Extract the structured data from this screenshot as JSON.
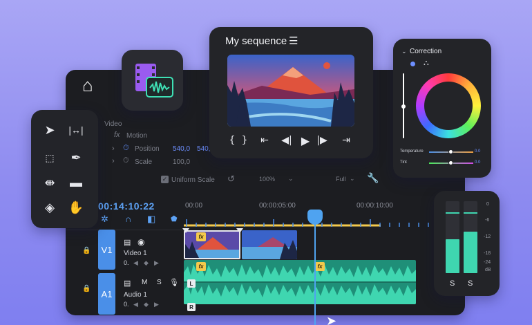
{
  "monitor": {
    "title": "My sequence",
    "menu_icon": "hamburger-icon",
    "transport": [
      "{",
      "}",
      "go-to-in",
      "step-back",
      "play",
      "step-forward",
      "go-to-out"
    ]
  },
  "correction": {
    "title": "Correction",
    "sliders": [
      {
        "label": "Temperature",
        "value": "0.0"
      },
      {
        "label": "Tint",
        "value": "0.0"
      }
    ],
    "colors": {
      "accent": "#4a8fe8"
    }
  },
  "effects": {
    "section": "Video",
    "effect": "Motion",
    "fx_glyph": "fx",
    "params": [
      {
        "label": "Position",
        "x": "540,0",
        "y": "540,"
      },
      {
        "label": "Scale",
        "value": "100,0"
      }
    ],
    "uniform_scale": "Uniform Scale",
    "zoom": "100%",
    "quality": "Full"
  },
  "timeline": {
    "timecode": "00:14:10:22",
    "ruler": [
      "00:00",
      "00:00:05:00",
      "00:00:10:00"
    ],
    "playhead_fraction": 0.53,
    "tracks": [
      {
        "id": "V1",
        "name": "Video 1"
      },
      {
        "id": "A1",
        "name": "Audio 1",
        "mute": "M",
        "solo": "S"
      }
    ],
    "clip_badges": [
      "fx",
      "fx",
      "fx"
    ],
    "channel_badges": [
      "L",
      "R"
    ],
    "track_value": "0."
  },
  "meter": {
    "scale": [
      "0",
      "-6",
      "-12",
      "-18",
      "-24",
      "dB"
    ],
    "channels": [
      "S",
      "S"
    ],
    "levels": [
      0.38,
      0.47
    ]
  }
}
